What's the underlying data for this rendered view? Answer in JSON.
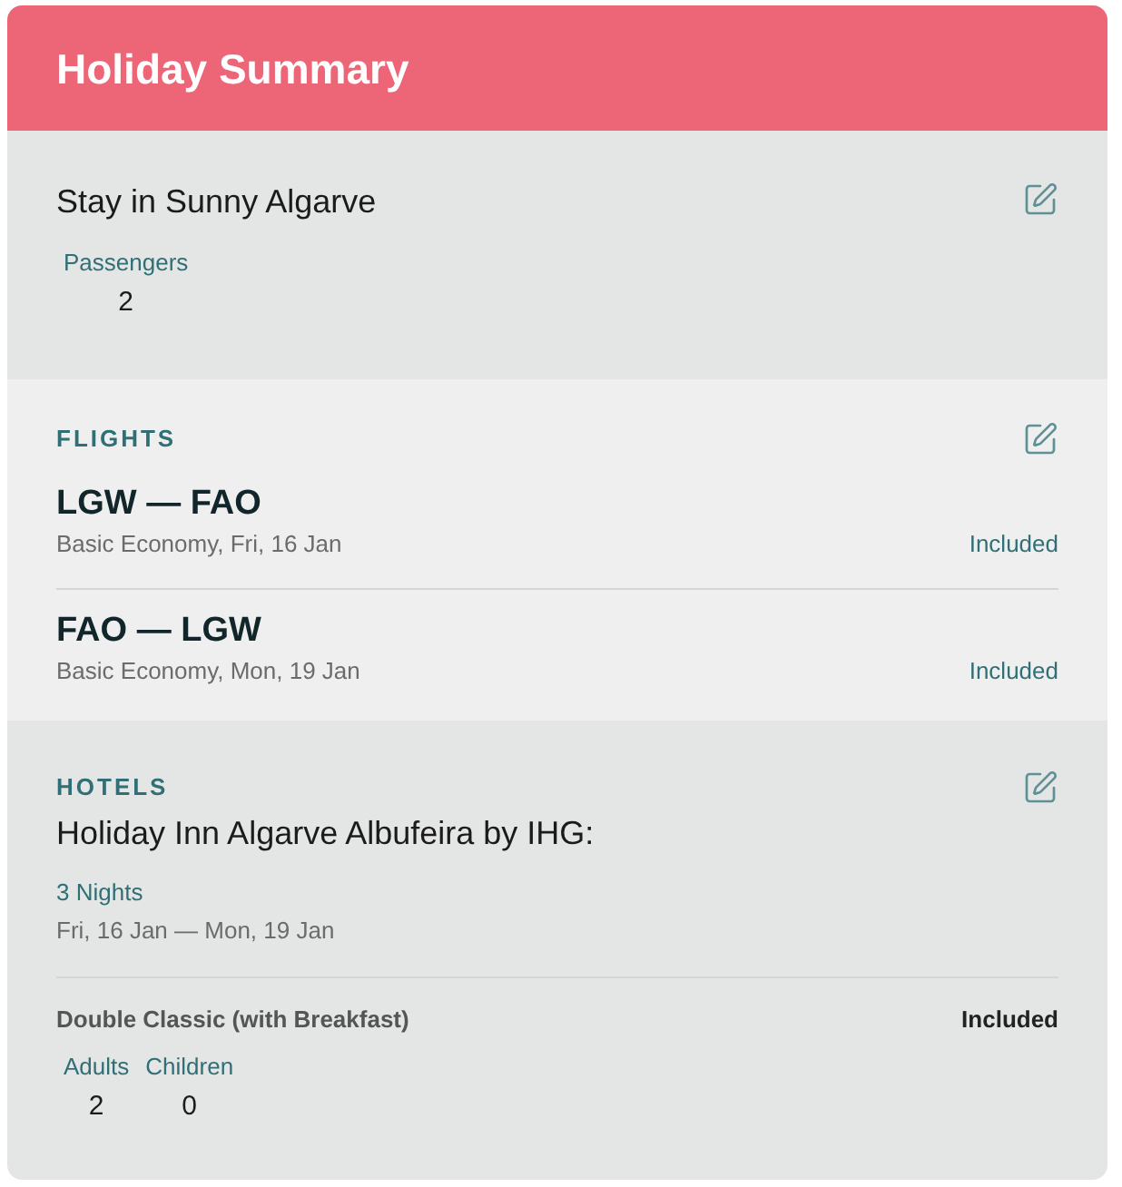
{
  "header": {
    "title": "Holiday Summary"
  },
  "trip": {
    "title": "Stay in Sunny Algarve",
    "counts": [
      {
        "label": "Passengers",
        "value": "2"
      }
    ]
  },
  "flights": {
    "heading": "FLIGHTS",
    "items": [
      {
        "route": "LGW — FAO",
        "details": "Basic Economy, Fri, 16 Jan",
        "status": "Included"
      },
      {
        "route": "FAO — LGW",
        "details": "Basic Economy, Mon, 19 Jan",
        "status": "Included"
      }
    ]
  },
  "hotels": {
    "heading": "HOTELS",
    "name": "Holiday Inn Algarve Albufeira by IHG:",
    "nights": "3 Nights",
    "dates": "Fri, 16 Jan — Mon, 19 Jan",
    "rooms": [
      {
        "name": "Double Classic (with Breakfast)",
        "status": "Included",
        "counts": [
          {
            "label": "Adults",
            "value": "2"
          },
          {
            "label": "Children",
            "value": "0"
          }
        ]
      }
    ]
  }
}
